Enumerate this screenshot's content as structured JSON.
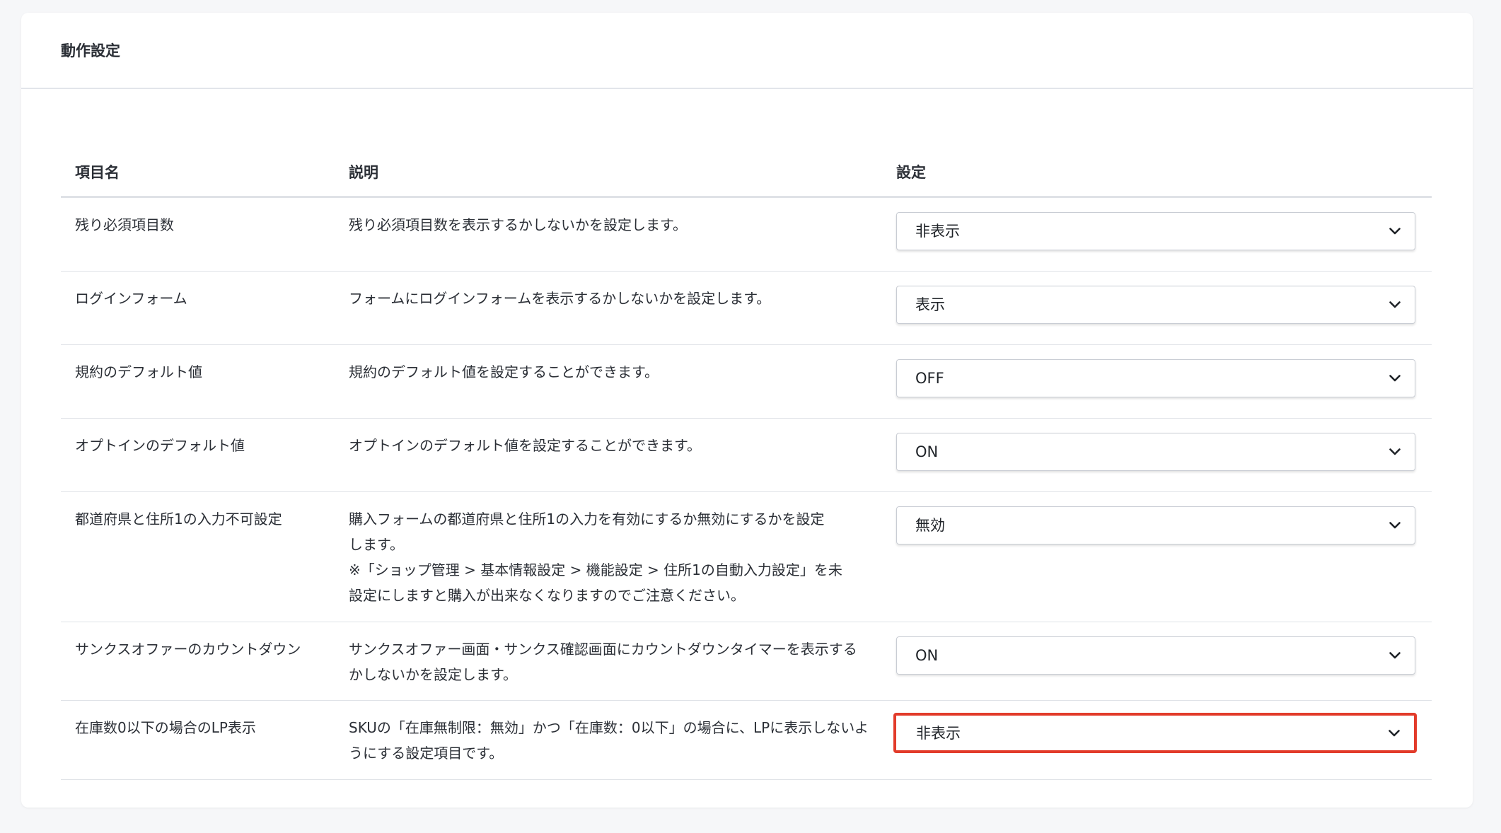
{
  "card": {
    "title": "動作設定"
  },
  "table": {
    "headers": {
      "name": "項目名",
      "description": "説明",
      "setting": "設定"
    },
    "rows": [
      {
        "name": "残り必須項目数",
        "description": "残り必須項目数を表示するかしないかを設定します。",
        "value": "非表示"
      },
      {
        "name": "ログインフォーム",
        "description": "フォームにログインフォームを表示するかしないかを設定します。",
        "value": "表示"
      },
      {
        "name": "規約のデフォルト値",
        "description": "規約のデフォルト値を設定することができます。",
        "value": "OFF"
      },
      {
        "name": "オプトインのデフォルト値",
        "description": "オプトインのデフォルト値を設定することができます。",
        "value": "ON"
      },
      {
        "name": "都道府県と住所1の入力不可設定",
        "description_lines": [
          "購入フォームの都道府県と住所1の入力を有効にするか無効にするかを設定",
          "します。",
          "※「ショップ管理 > 基本情報設定 > 機能設定 > 住所1の自動入力設定」を未",
          "設定にしますと購入が出来なくなりますのでご注意ください。"
        ],
        "value": "無効"
      },
      {
        "name": "サンクスオファーのカウントダウン",
        "description_lines": [
          "サンクスオファー画面・サンクス確認画面にカウントダウンタイマーを表示する",
          "かしないかを設定します。"
        ],
        "value": "ON"
      },
      {
        "name": "在庫数0以下の場合のLP表示",
        "description_lines": [
          "SKUの「在庫無制限：無効」かつ「在庫数：0以下」の場合に、LPに表示しないよ",
          "うにする設定項目です。"
        ],
        "value": "非表示"
      }
    ]
  },
  "icons": {
    "select_arrow": "chevron-down-icon"
  },
  "colors": {
    "highlight": "#e23b2a",
    "divider": "#dfe2e7"
  }
}
